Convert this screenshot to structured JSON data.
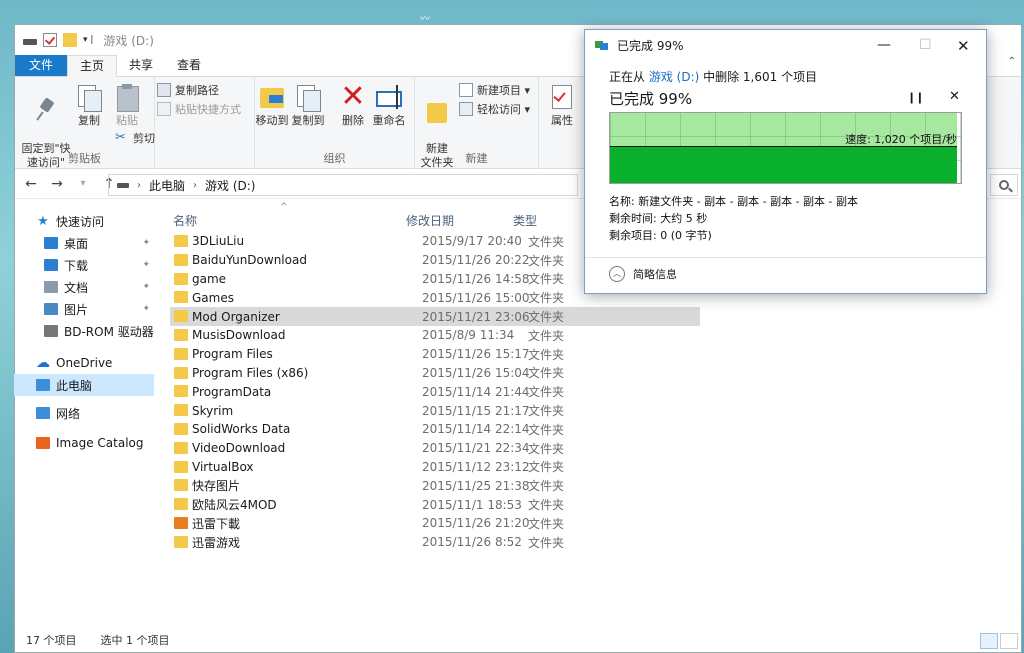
{
  "explorer": {
    "title": "游戏 (D:)",
    "tabs": [
      "文件",
      "主页",
      "共享",
      "查看"
    ],
    "ribbon": {
      "clipboard": {
        "pin": "固定到\"快\n速访问\"",
        "copy": "复制",
        "paste": "粘贴",
        "copy_path": "复制路径",
        "paste_shortcut": "粘贴快捷方式",
        "cut": "剪切",
        "label": "剪贴板"
      },
      "organize": {
        "move_to": "移动到",
        "copy_to": "复制到",
        "delete": "删除",
        "rename": "重命名",
        "label": "组织"
      },
      "new": {
        "new_folder": "新建\n文件夹",
        "new_item": "新建项目 ▾",
        "easy_access": "轻松访问 ▾",
        "label": "新建"
      },
      "open": {
        "properties": "属性"
      }
    },
    "address": {
      "crumbs": [
        "此电脑",
        "游戏 (D:)"
      ]
    },
    "nav": [
      {
        "label": "快速访问",
        "icon": "star-icon",
        "level": 0,
        "pinned": false
      },
      {
        "label": "桌面",
        "icon": "desktop-icon",
        "level": 1,
        "pinned": true,
        "color": "#2a7fd4"
      },
      {
        "label": "下载",
        "icon": "download-icon",
        "level": 1,
        "pinned": true,
        "color": "#2a7fd4"
      },
      {
        "label": "文档",
        "icon": "documents-icon",
        "level": 1,
        "pinned": true,
        "color": "#8a9aaa"
      },
      {
        "label": "图片",
        "icon": "pictures-icon",
        "level": 1,
        "pinned": true,
        "color": "#4a8ac4"
      },
      {
        "label": "BD-ROM 驱动器",
        "icon": "disc-drive-icon",
        "level": 1,
        "pinned": true,
        "color": "#777"
      },
      {
        "label": "OneDrive",
        "icon": "onedrive-icon",
        "level": 0,
        "pinned": false
      },
      {
        "label": "此电脑",
        "icon": "this-pc-icon",
        "level": 0,
        "pinned": false,
        "selected": true,
        "color": "#3a8fd8"
      },
      {
        "label": "网络",
        "icon": "network-icon",
        "level": 0,
        "pinned": false,
        "color": "#3a8fd8"
      },
      {
        "label": "Image Catalog",
        "icon": "image-catalog-icon",
        "level": 0,
        "pinned": false,
        "color": "#e8641e"
      }
    ],
    "columns": {
      "name": "名称",
      "date": "修改日期",
      "type": "类型"
    },
    "files": [
      {
        "name": "3DLiuLiu",
        "date": "2015/9/17 20:40",
        "type": "文件夹"
      },
      {
        "name": "BaiduYunDownload",
        "date": "2015/11/26 20:22",
        "type": "文件夹"
      },
      {
        "name": "game",
        "date": "2015/11/26 14:58",
        "type": "文件夹"
      },
      {
        "name": "Games",
        "date": "2015/11/26 15:00",
        "type": "文件夹"
      },
      {
        "name": "Mod Organizer",
        "date": "2015/11/21 23:06",
        "type": "文件夹",
        "selected": true
      },
      {
        "name": "MusisDownload",
        "date": "2015/8/9 11:34",
        "type": "文件夹"
      },
      {
        "name": "Program Files",
        "date": "2015/11/26 15:17",
        "type": "文件夹"
      },
      {
        "name": "Program Files (x86)",
        "date": "2015/11/26 15:04",
        "type": "文件夹"
      },
      {
        "name": "ProgramData",
        "date": "2015/11/14 21:44",
        "type": "文件夹"
      },
      {
        "name": "Skyrim",
        "date": "2015/11/15 21:17",
        "type": "文件夹"
      },
      {
        "name": "SolidWorks Data",
        "date": "2015/11/14 22:14",
        "type": "文件夹"
      },
      {
        "name": "VideoDownload",
        "date": "2015/11/21 22:34",
        "type": "文件夹"
      },
      {
        "name": "VirtualBox",
        "date": "2015/11/12 23:12",
        "type": "文件夹"
      },
      {
        "name": "快存图片",
        "date": "2015/11/25 21:38",
        "type": "文件夹"
      },
      {
        "name": "欧陆风云4MOD",
        "date": "2015/11/1 18:53",
        "type": "文件夹"
      },
      {
        "name": "迅雷下載",
        "date": "2015/11/26 21:20",
        "type": "文件夹",
        "app": true
      },
      {
        "name": "迅雷游戏",
        "date": "2015/11/26 8:52",
        "type": "文件夹"
      }
    ],
    "status": {
      "count": "17 个项目",
      "selected": "选中 1 个项目"
    }
  },
  "dialog": {
    "title": "已完成 99%",
    "line1_prefix": "正在从 ",
    "line1_source": "游戏 (D:)",
    "line1_suffix": " 中删除 1,601 个项目",
    "percent_text": "已完成 99%",
    "progress": 0.99,
    "speed": "速度: 1,020 个项目/秒",
    "name": "名称: 新建文件夹 - 副本 - 副本 - 副本 - 副本 - 副本",
    "time_left": "剩余时间: 大约 5 秒",
    "items_left": "剩余项目: 0 (0 字节)",
    "less_info": "简略信息"
  }
}
